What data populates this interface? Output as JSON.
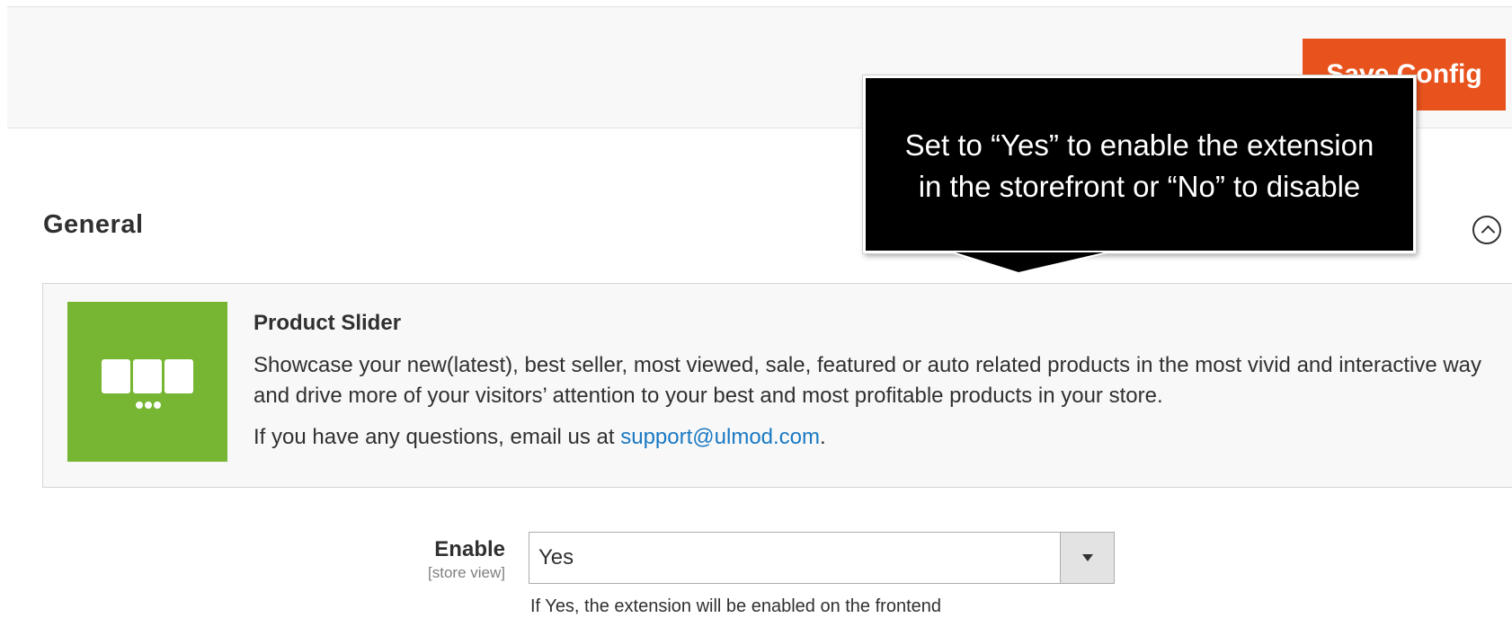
{
  "toolbar": {
    "save_label": "Save Config"
  },
  "section": {
    "title": "General",
    "collapse_icon": "chevron-up-circle-icon"
  },
  "info_panel": {
    "logo_icon": "product-slider-logo-icon",
    "logo_color": "#76b632",
    "title": "Product Slider",
    "description": "Showcase your new(latest), best seller, most viewed, sale, featured or auto related products in the most vivid and interactive way and drive more of your visitors’ attention to your best and most profitable products in your store.",
    "contact_prefix": "If you have any questions, email us at ",
    "contact_email": "support@ulmod.com",
    "contact_suffix": "."
  },
  "form": {
    "enable": {
      "label": "Enable",
      "scope": "[store view]",
      "value": "Yes",
      "note": "If Yes, the extension will be enabled on the frontend"
    }
  },
  "callout": {
    "line1": "Set  to “Yes” to enable the extension",
    "line2": "in the storefront or “No” to disable"
  },
  "colors": {
    "accent": "#e8531d",
    "link": "#1979c3"
  }
}
